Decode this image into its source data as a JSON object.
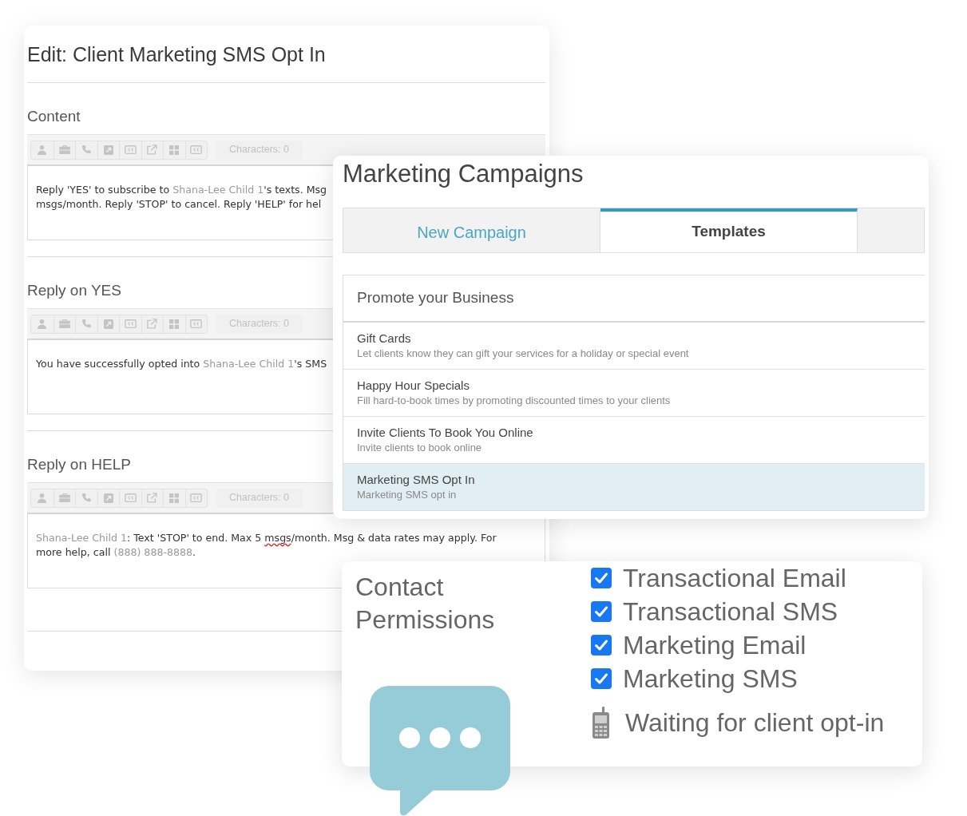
{
  "editor": {
    "title": "Edit: Client Marketing SMS Opt In",
    "sections": [
      {
        "label": "Content",
        "toolbar_disabled": true,
        "counter": "Characters: 0",
        "lines": [
          [
            {
              "kind": "plain",
              "text": "Reply 'YES' to subscribe to "
            },
            {
              "kind": "merge_field",
              "text": "Shana-Lee Child 1"
            },
            {
              "kind": "plain",
              "text": "'s texts. Msg"
            }
          ],
          [
            {
              "kind": "plain",
              "text": "msgs/month. Reply 'STOP' to cancel. Reply 'HELP' for hel"
            }
          ]
        ]
      },
      {
        "label": "Reply on YES",
        "toolbar_disabled": true,
        "counter": "Characters: 0",
        "lines": [
          [
            {
              "kind": "plain",
              "text": "You have successfully opted into "
            },
            {
              "kind": "merge_field",
              "text": "Shana-Lee Child 1"
            },
            {
              "kind": "plain",
              "text": "'s SMS"
            }
          ]
        ]
      },
      {
        "label": "Reply on HELP",
        "toolbar_disabled": true,
        "counter": "Characters: 0",
        "lines": [
          [
            {
              "kind": "merge_field",
              "text": "Shana-Lee Child 1"
            },
            {
              "kind": "plain",
              "text": ": Text 'STOP' to end. Max 5 "
            },
            {
              "kind": "misspelled",
              "text": "msgs"
            },
            {
              "kind": "plain",
              "text": "/month. Msg & data rates may apply. For"
            }
          ],
          [
            {
              "kind": "plain",
              "text": "more help, call "
            },
            {
              "kind": "merge_field",
              "text": "(888) 888-8888"
            },
            {
              "kind": "plain",
              "text": "."
            }
          ]
        ]
      }
    ]
  },
  "campaigns": {
    "title": "Marketing Campaigns",
    "tabs": [
      {
        "label": "New Campaign",
        "selected": false
      },
      {
        "label": "Templates",
        "selected": true
      }
    ],
    "templates": {
      "header": "Promote your Business",
      "items": [
        {
          "title": "Gift Cards",
          "description": "Let clients know they can gift your services for a holiday or special event",
          "selected": false
        },
        {
          "title": "Happy Hour Specials",
          "description": "Fill hard-to-book times by promoting discounted times to your clients",
          "selected": false
        },
        {
          "title": "Invite Clients To Book You Online",
          "description": "Invite clients to book online",
          "selected": false
        },
        {
          "title": "Marketing SMS Opt In",
          "description": "Marketing SMS opt in",
          "selected": true
        }
      ]
    }
  },
  "permissions": {
    "title": "Contact Permissions",
    "items": [
      {
        "label": "Transactional Email",
        "checked": true
      },
      {
        "label": "Transactional SMS",
        "checked": true
      },
      {
        "label": "Marketing Email",
        "checked": true
      },
      {
        "label": "Marketing SMS",
        "checked": true
      }
    ],
    "status": "Waiting for client opt-in"
  }
}
